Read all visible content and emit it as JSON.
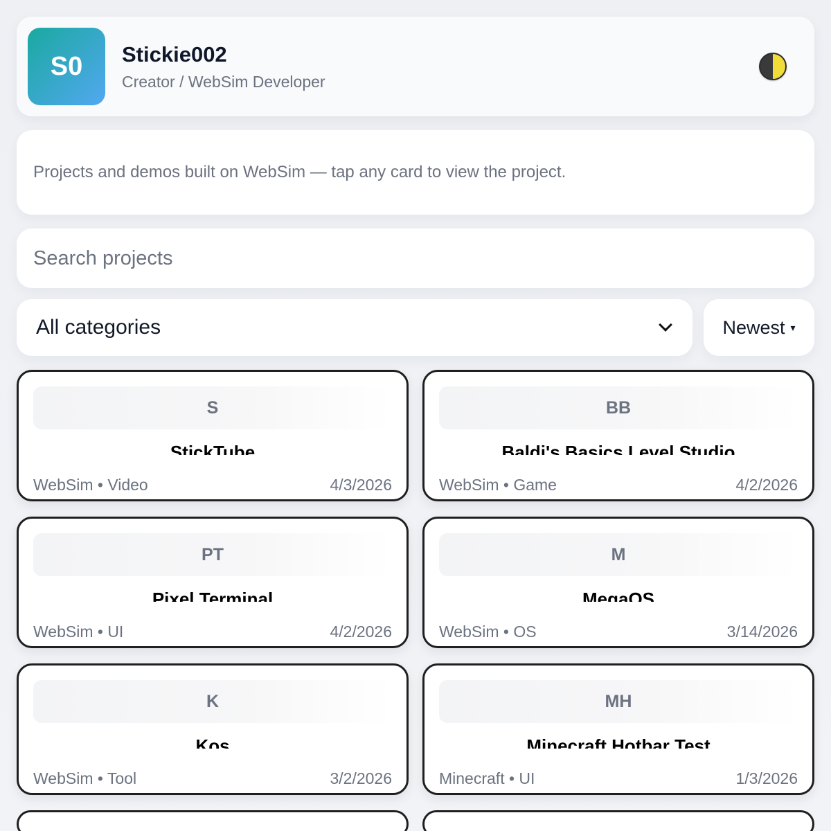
{
  "profile": {
    "initials": "S0",
    "name": "Stickie002",
    "role": "Creator / WebSim Developer"
  },
  "theme_toggle": {
    "icon": "half-moon-icon"
  },
  "intro": {
    "text": "Projects and demos built on WebSim — tap any card to view the project."
  },
  "search": {
    "placeholder": "Search projects",
    "value": ""
  },
  "filters": {
    "category_selected": "All categories",
    "sort_selected": "Newest",
    "sort_caret": "▾"
  },
  "projects": [
    {
      "thumb": "S",
      "title": "StickTube",
      "meta": "WebSim • Video",
      "date": "4/3/2026"
    },
    {
      "thumb": "BB",
      "title": "Baldi's Basics Level Studio",
      "meta": "WebSim • Game",
      "date": "4/2/2026"
    },
    {
      "thumb": "PT",
      "title": "Pixel Terminal",
      "meta": "WebSim • UI",
      "date": "4/2/2026"
    },
    {
      "thumb": "M",
      "title": "MegaOS",
      "meta": "WebSim • OS",
      "date": "3/14/2026"
    },
    {
      "thumb": "K",
      "title": "Kos",
      "meta": "WebSim • Tool",
      "date": "3/2/2026"
    },
    {
      "thumb": "MH",
      "title": "Minecraft Hotbar Test",
      "meta": "Minecraft • UI",
      "date": "1/3/2026"
    }
  ],
  "colors": {
    "avatar_gradient_start": "#1aa9a0",
    "avatar_gradient_end": "#52a8f0",
    "page_background": "#eef0f4",
    "card_border": "#1f1f1f",
    "muted_text": "#6b7280"
  }
}
